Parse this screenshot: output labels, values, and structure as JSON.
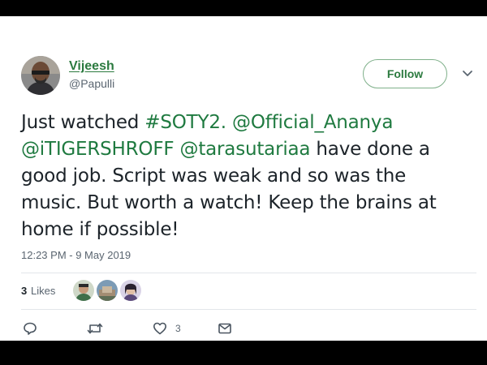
{
  "author": {
    "name": "Vijeesh",
    "handle": "@Papulli"
  },
  "follow_label": "Follow",
  "tweet": {
    "lines": [
      [
        {
          "text": "Just watched ",
          "link": false
        },
        {
          "text": "#SOTY2.",
          "link": true
        },
        {
          "text": " ",
          "link": false
        },
        {
          "text": "@Official_Ananya",
          "link": true
        }
      ],
      [
        {
          "text": "@iTIGERSHROFF",
          "link": true
        },
        {
          "text": " ",
          "link": false
        },
        {
          "text": "@tarasutariaa",
          "link": true
        },
        {
          "text": " have done a",
          "link": false
        }
      ],
      [
        {
          "text": "good job. Script was weak and so was the",
          "link": false
        }
      ],
      [
        {
          "text": "music. But worth a watch! Keep the brains at",
          "link": false
        }
      ],
      [
        {
          "text": "home if possible!",
          "link": false
        }
      ]
    ]
  },
  "timestamp": "12:23 PM - 9 May 2019",
  "likes": {
    "count": "3",
    "label": "Likes"
  },
  "actions": {
    "like_count": "3"
  },
  "icons": {
    "more": "chevron-down-icon",
    "reply": "reply-icon",
    "retweet": "retweet-icon",
    "like": "heart-icon",
    "message": "envelope-icon"
  },
  "colors": {
    "accent": "#1f7a40",
    "text": "#1c2329",
    "muted": "#5a6570",
    "border": "#e2e6ea"
  }
}
